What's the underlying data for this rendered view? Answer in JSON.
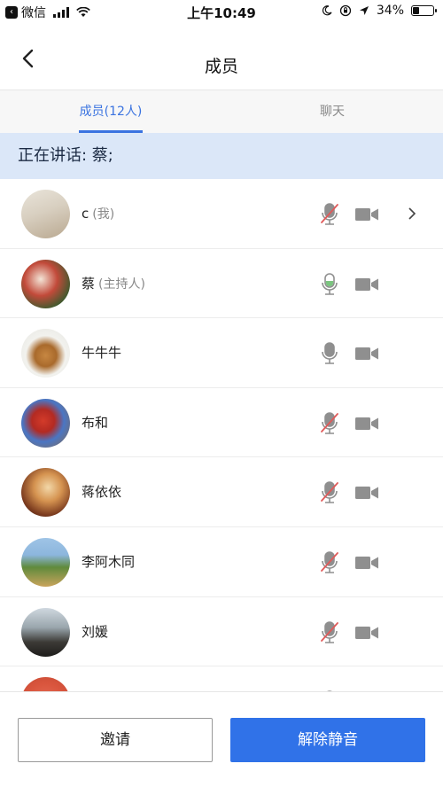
{
  "status_bar": {
    "back_app": "微信",
    "time": "上午10:49",
    "battery": "34%",
    "battery_level": 0.34
  },
  "nav": {
    "title": "成员"
  },
  "tabs": [
    {
      "label": "成员(12人)",
      "active": true
    },
    {
      "label": "聊天",
      "active": false
    }
  ],
  "speaking": "正在讲话: 蔡;",
  "members": [
    {
      "name": "c",
      "role": "(我)",
      "mic": "muted",
      "chevron": true
    },
    {
      "name": "蔡",
      "role": "(主持人)",
      "mic": "active",
      "chevron": false
    },
    {
      "name": "牛牛牛",
      "role": "",
      "mic": "on",
      "chevron": false
    },
    {
      "name": "布和",
      "role": "",
      "mic": "muted",
      "chevron": false
    },
    {
      "name": "蒋依依",
      "role": "",
      "mic": "muted",
      "chevron": false
    },
    {
      "name": "李阿木同",
      "role": "",
      "mic": "muted",
      "chevron": false
    },
    {
      "name": "刘媛",
      "role": "",
      "mic": "muted",
      "chevron": false
    },
    {
      "name": "",
      "role": "",
      "mic": "muted",
      "chevron": false
    }
  ],
  "buttons": {
    "invite": "邀请",
    "unmute": "解除静音"
  },
  "colors": {
    "accent": "#3072e8",
    "mic_active": "#7bc47f",
    "muted_slash": "#e05a5a"
  },
  "icons": [
    "back-app-icon",
    "signal-icon",
    "wifi-icon",
    "moon-icon",
    "lock-rotation-icon",
    "location-icon",
    "battery-icon",
    "back-icon",
    "microphone-icon",
    "microphone-muted-icon",
    "camera-icon",
    "chevron-right-icon"
  ]
}
